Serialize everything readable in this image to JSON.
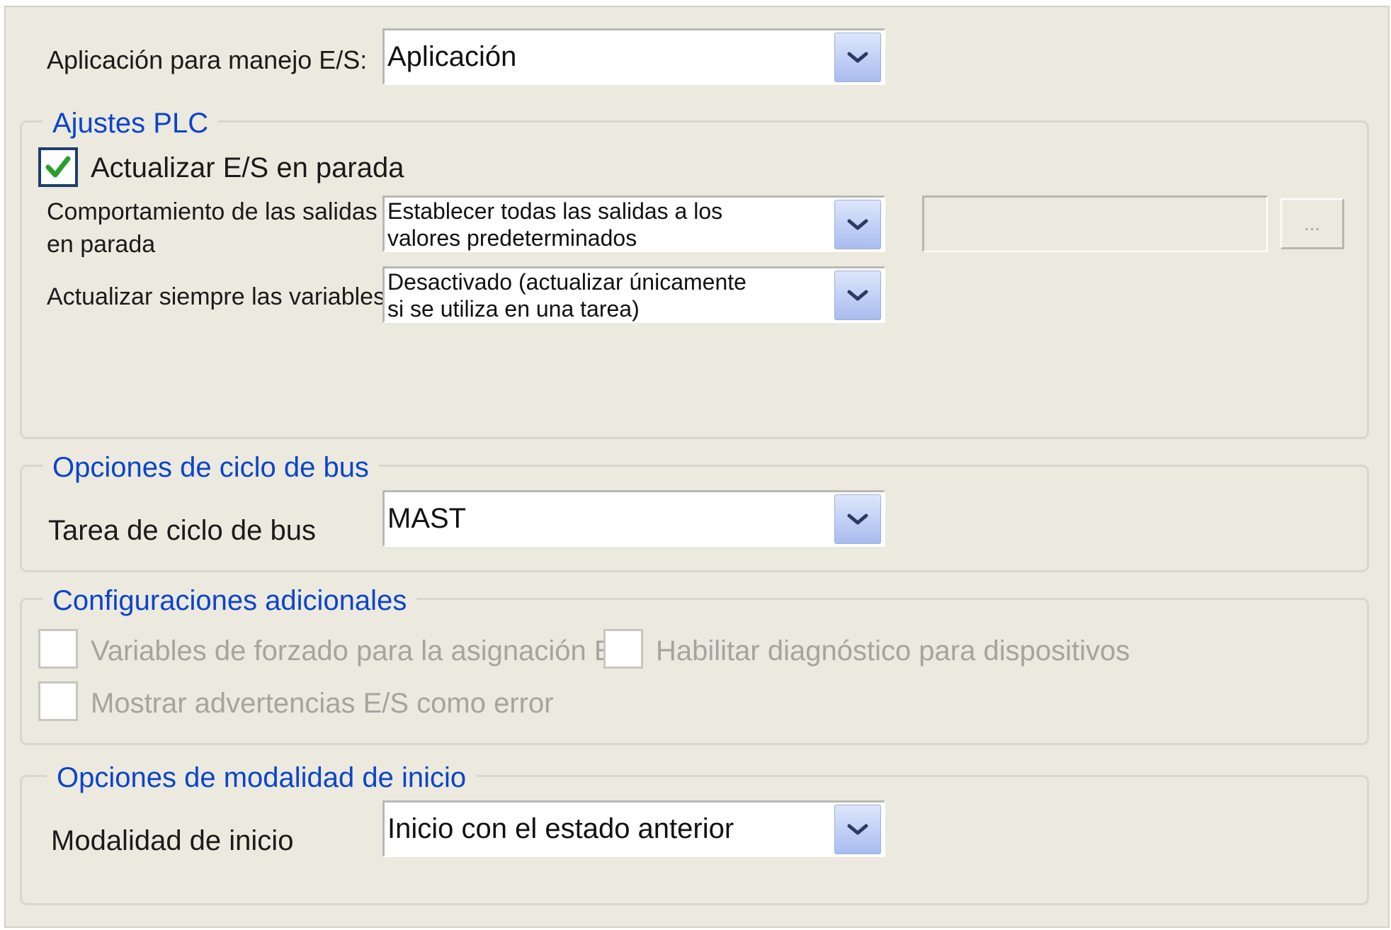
{
  "io_app": {
    "label": "Aplicación para manejo E/S:",
    "value": "Aplicación"
  },
  "plc_settings": {
    "title": "Ajustes PLC",
    "update_io_on_stop": {
      "label": "Actualizar E/S en parada",
      "checked": true
    },
    "outputs_behavior": {
      "label": "Comportamiento de las salidas\nen parada",
      "value": "Establecer todas las salidas a los\nvalores predeterminados"
    },
    "update_variables": {
      "label": "Actualizar siempre las variables",
      "value": "Desactivado (actualizar únicamente\nsi se utiliza en una tarea)"
    },
    "browse_button": "..."
  },
  "bus_cycle": {
    "title": "Opciones de ciclo de bus",
    "task_label": "Tarea de ciclo de bus",
    "task_value": "MAST"
  },
  "additional": {
    "title": "Configuraciones adicionales",
    "force_variables": {
      "label": "Variables de forzado para la asignación E/S",
      "checked": false
    },
    "enable_diagnostics": {
      "label": "Habilitar diagnóstico para dispositivos",
      "checked": false
    },
    "warnings_as_errors": {
      "label": "Mostrar advertencias E/S como error",
      "checked": false
    }
  },
  "startup": {
    "title": "Opciones de modalidad de inicio",
    "mode_label": "Modalidad de inicio",
    "mode_value": "Inicio con el estado anterior"
  },
  "colors": {
    "panel_bg": "#ece9df",
    "group_title": "#0a45c9",
    "check_green": "#2aa02a",
    "disabled_text": "#a6a49e"
  },
  "icons": {
    "dropdown": "chevron-down-icon",
    "check": "checkmark-icon"
  }
}
